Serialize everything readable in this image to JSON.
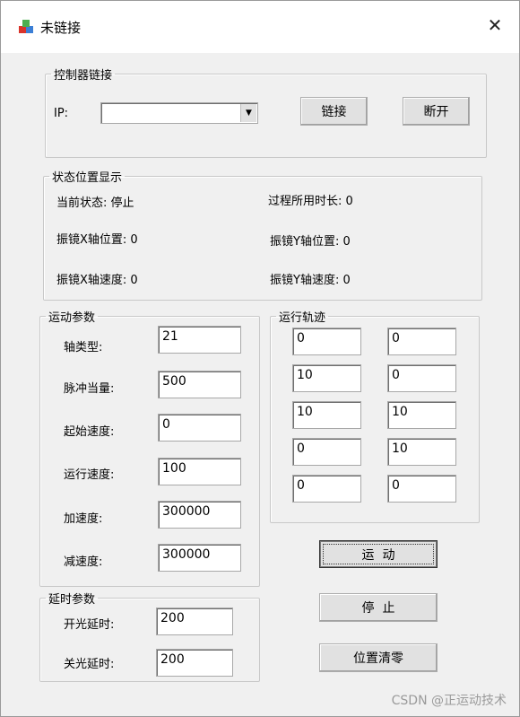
{
  "window": {
    "title": "未链接",
    "close_glyph": "✕"
  },
  "controller": {
    "legend": "控制器链接",
    "ip_label": "IP:",
    "ip_value": "",
    "connect_label": "链接",
    "disconnect_label": "断开"
  },
  "status": {
    "legend": "状态位置显示",
    "current_state": "当前状态: 停止",
    "elapsed": "过程所用时长: 0",
    "x_pos": "振镜X轴位置: 0",
    "y_pos": "振镜Y轴位置: 0",
    "x_speed": "振镜X轴速度: 0",
    "y_speed": "振镜Y轴速度: 0"
  },
  "motion": {
    "legend": "运动参数",
    "fields": [
      {
        "label": "轴类型:",
        "value": "21"
      },
      {
        "label": "脉冲当量:",
        "value": "500"
      },
      {
        "label": "起始速度:",
        "value": "0"
      },
      {
        "label": "运行速度:",
        "value": "100"
      },
      {
        "label": "加速度:",
        "value": "300000"
      },
      {
        "label": "减速度:",
        "value": "300000"
      }
    ]
  },
  "trajectory": {
    "legend": "运行轨迹",
    "rows": [
      [
        "0",
        "0"
      ],
      [
        "10",
        "0"
      ],
      [
        "10",
        "10"
      ],
      [
        "0",
        "10"
      ],
      [
        "0",
        "0"
      ]
    ]
  },
  "delay": {
    "legend": "延时参数",
    "fields": [
      {
        "label": "开光延时:",
        "value": "200"
      },
      {
        "label": "关光延时:",
        "value": "200"
      }
    ]
  },
  "actions": {
    "run_label": "运  动",
    "stop_label": "停  止",
    "zero_label": "位置清零"
  },
  "watermark": "CSDN @正运动技术",
  "icons": {
    "app": "app-icon",
    "close": "close-icon",
    "dropdown": "chevron-down-icon"
  }
}
